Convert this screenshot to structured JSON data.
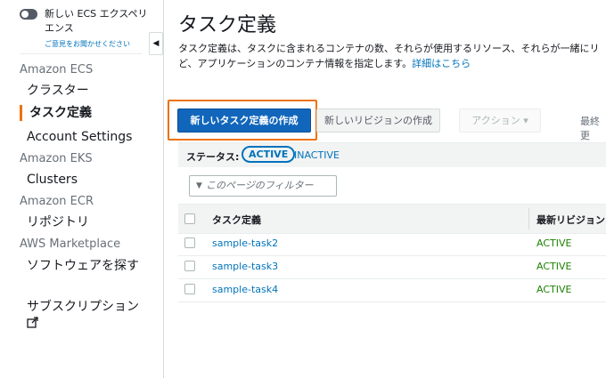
{
  "sidebar": {
    "toggle_label": "新しい ECS エクスペリエンス",
    "feedback": "ご意見をお聞かせください",
    "collapse_icon": "◀",
    "sections": [
      {
        "title": "Amazon ECS",
        "items": [
          "クラスター",
          "タスク定義",
          "Account Settings"
        ]
      },
      {
        "title": "Amazon EKS",
        "items": [
          "Clusters"
        ]
      },
      {
        "title": "Amazon ECR",
        "items": [
          "リポジトリ"
        ]
      },
      {
        "title": "AWS Marketplace",
        "items": [
          "ソフトウェアを探す",
          "サブスクリプション"
        ]
      }
    ],
    "active_item": "タスク定義",
    "accent_color": "#ec7211"
  },
  "main": {
    "title": "タスク定義",
    "desc_line1": "タスク定義は、タスクに含まれるコンテナの数、それらが使用するリソース、それらが一緒にリ",
    "desc_line2": "ど、アプリケーションのコンテナ情報を指定します。",
    "detail_link": "詳細はこちら",
    "toolbar": {
      "create_new": "新しいタスク定義の作成",
      "create_revision": "新しいリビジョンの作成",
      "actions": "アクション ▾",
      "last_updated": "最終更"
    },
    "status": {
      "label": "ステータス:",
      "active": "ACTIVE",
      "inactive": "INACTIVE"
    },
    "filter_placeholder": "このページのフィルター",
    "filter_icon": "filter-icon",
    "table": {
      "headers": [
        "タスク定義",
        "最新リビジョン"
      ],
      "rows": [
        {
          "name": "sample-task2",
          "status": "ACTIVE"
        },
        {
          "name": "sample-task3",
          "status": "ACTIVE"
        },
        {
          "name": "sample-task4",
          "status": "ACTIVE"
        }
      ]
    }
  }
}
